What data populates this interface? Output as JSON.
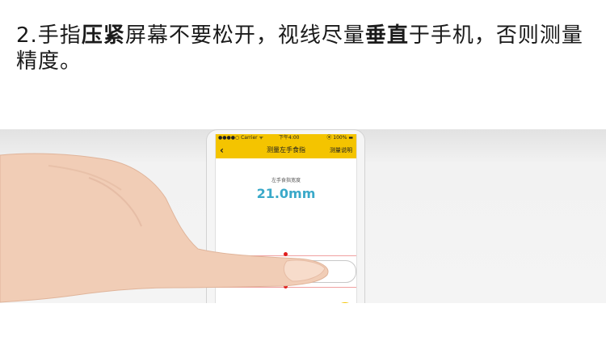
{
  "instruction": {
    "prefix": "2.手指",
    "bold1": "压紧",
    "mid": "屏幕不要松开，视线尽量",
    "bold2": "垂直",
    "suffix": "于手机，否则测量精度。"
  },
  "phone": {
    "status": {
      "carrier": "●●●●○ Carrier ᯤ",
      "time": "下午4:00",
      "battery": "⦿ 100% ▬"
    },
    "nav": {
      "back_icon": "‹",
      "title": "测量左手食指",
      "help": "测量说明"
    },
    "measure_label": "左手食指宽度",
    "measure_value": "21.0mm"
  },
  "colors": {
    "accent": "#f4c400",
    "value": "#3aa9c9",
    "marker": "#e01c1c"
  }
}
